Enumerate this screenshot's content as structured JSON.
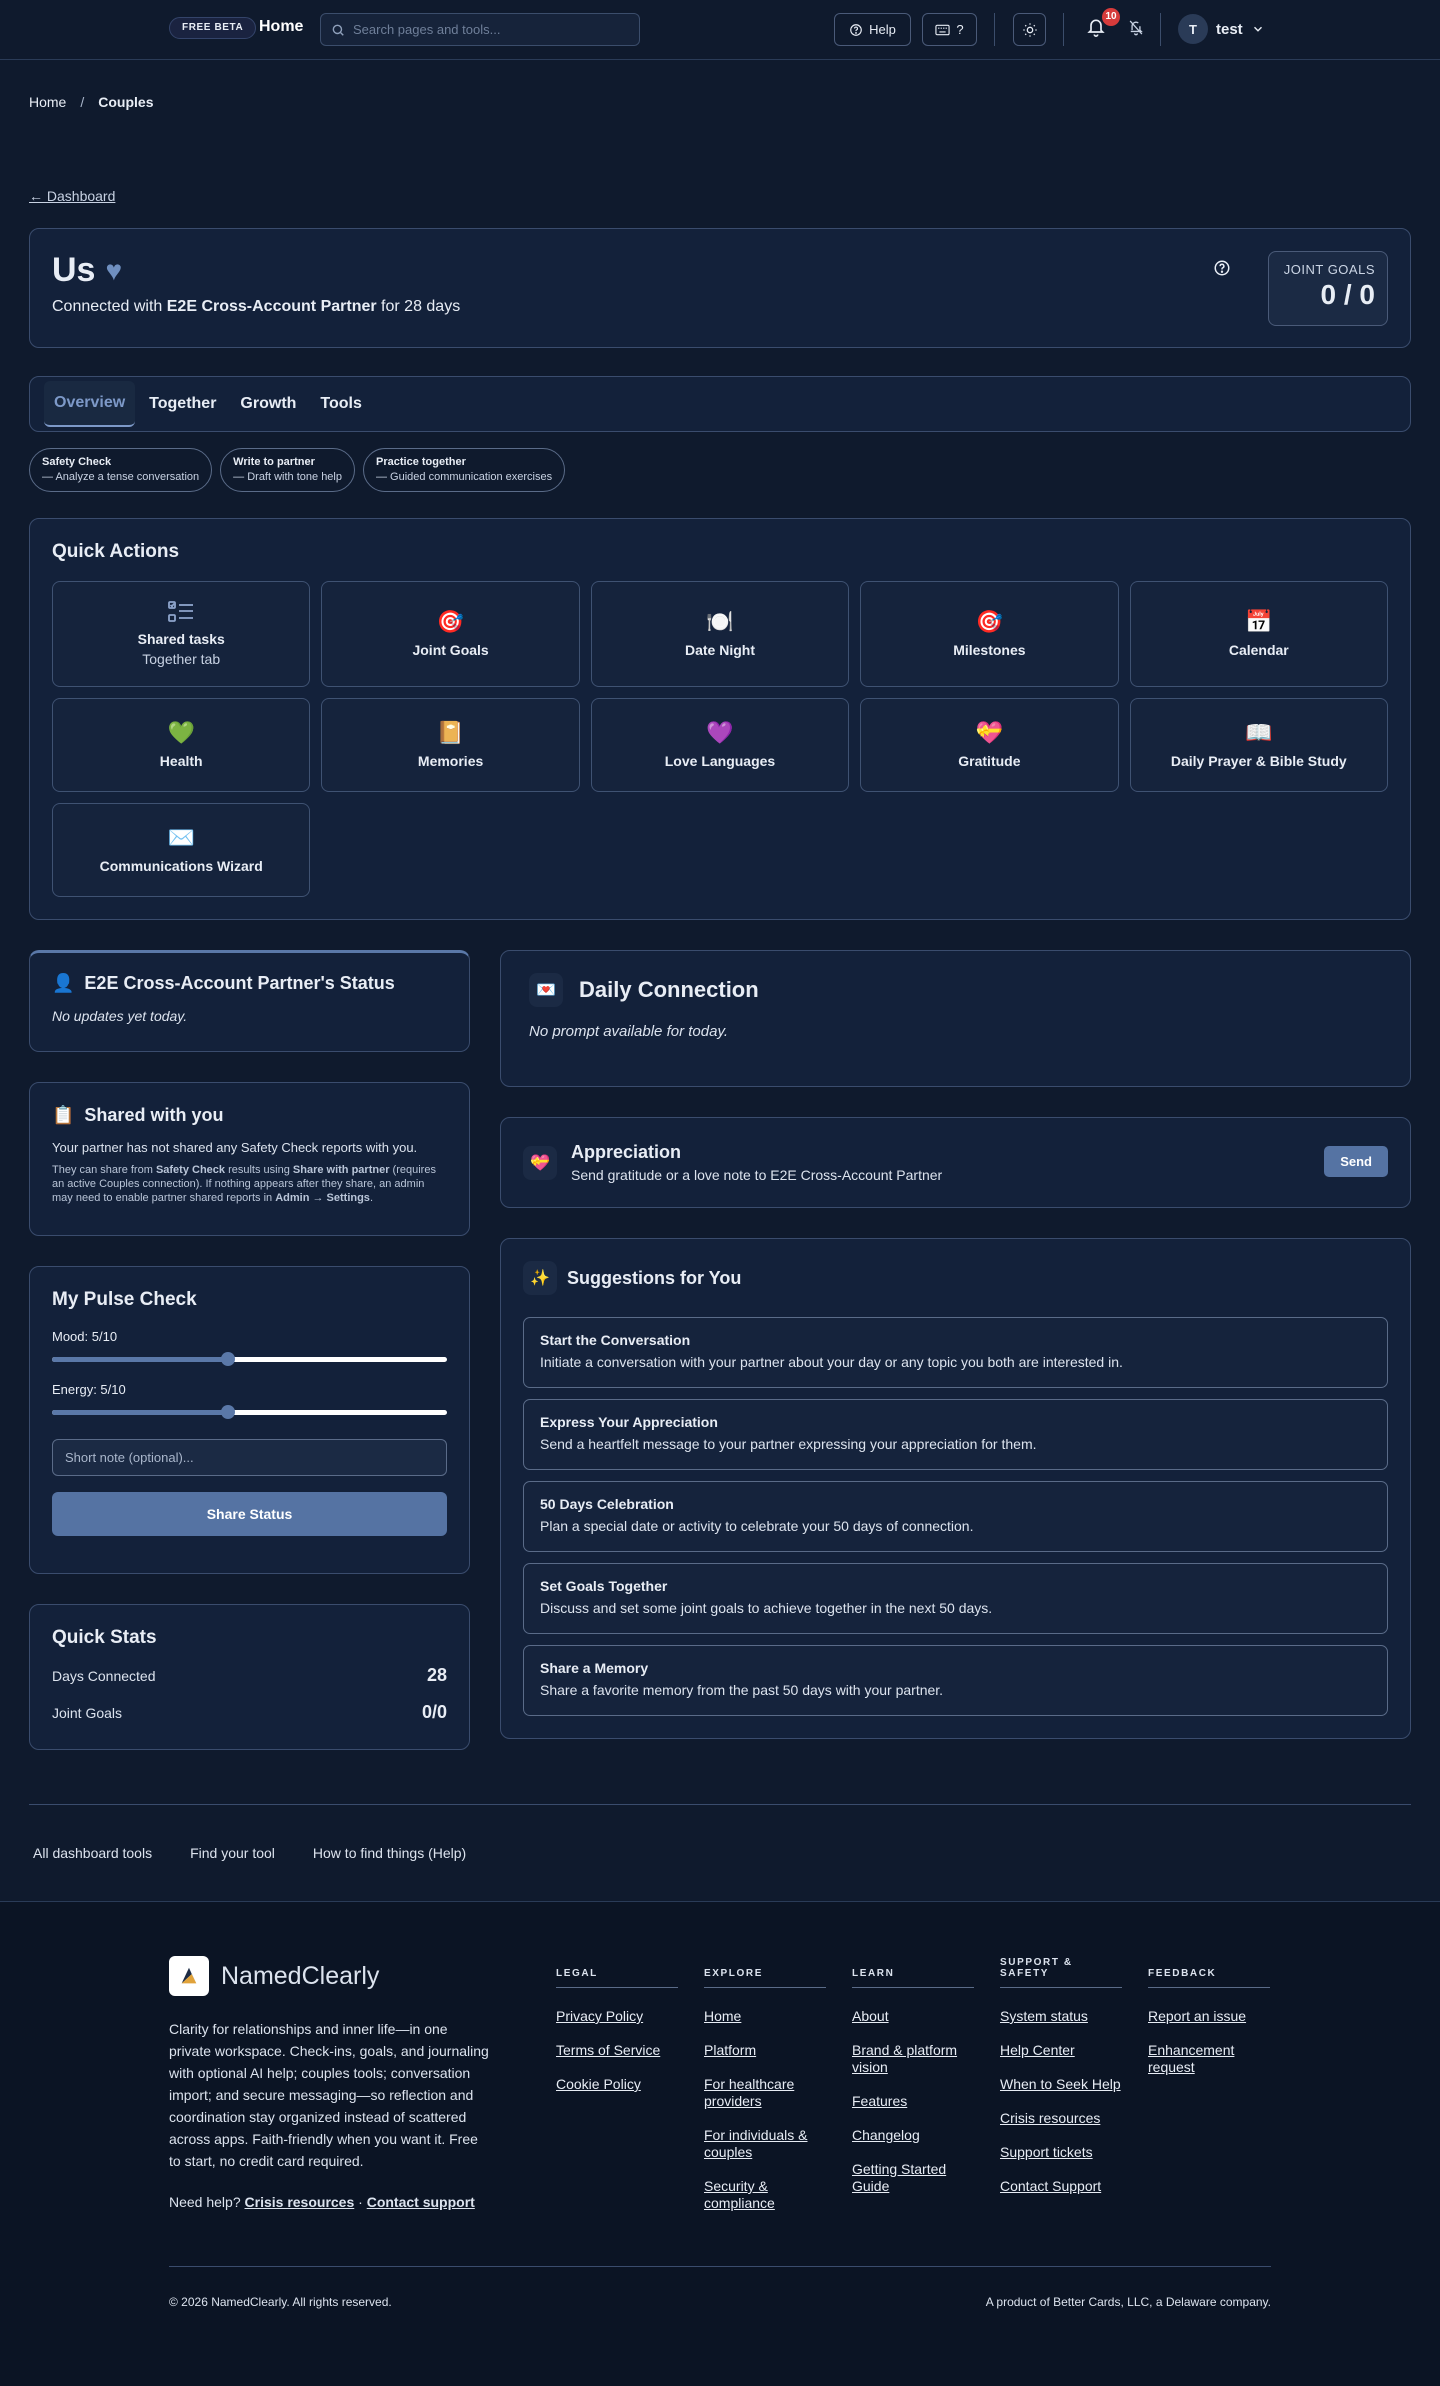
{
  "header": {
    "beta_label": "FREE BETA",
    "home_label": "Home",
    "search_placeholder": "Search pages and tools...",
    "help_label": "Help",
    "shortcuts_label": "?",
    "notification_count": "10",
    "user_initial": "T",
    "user_name": "test"
  },
  "breadcrumb": {
    "home": "Home",
    "sep": "/",
    "current": "Couples"
  },
  "back_link": "← Dashboard",
  "hero": {
    "title": "Us",
    "heart": "♥",
    "sub_prefix": "Connected with",
    "partner_name": "E2E Cross-Account Partner",
    "sub_suffix": "for 28 days",
    "goals_label": "JOINT GOALS",
    "goals_value": "0 / 0"
  },
  "tabs": [
    {
      "label": "Overview",
      "active": true
    },
    {
      "label": "Together"
    },
    {
      "label": "Growth"
    },
    {
      "label": "Tools"
    }
  ],
  "chips": [
    {
      "title": "Safety Check",
      "desc": "— Analyze a tense conversation"
    },
    {
      "title": "Write to partner",
      "desc": "— Draft with tone help"
    },
    {
      "title": "Practice together",
      "desc": "— Guided communication exercises"
    }
  ],
  "quick_actions": {
    "title": "Quick Actions",
    "items": [
      {
        "label": "Shared tasks",
        "sub": "Together tab",
        "icon": "checklist-icon"
      },
      {
        "label": "Joint Goals",
        "emoji": "🎯",
        "icon": "target-icon"
      },
      {
        "label": "Date Night",
        "emoji": "🍽️",
        "icon": "dinner-plate-icon"
      },
      {
        "label": "Milestones",
        "emoji": "🎯",
        "icon": "target-icon"
      },
      {
        "label": "Calendar",
        "emoji": "📅",
        "icon": "calendar-icon"
      },
      {
        "label": "Health",
        "emoji": "💚",
        "icon": "green-heart-icon"
      },
      {
        "label": "Memories",
        "emoji": "📔",
        "icon": "notebook-icon"
      },
      {
        "label": "Love Languages",
        "emoji": "💜",
        "icon": "purple-heart-icon"
      },
      {
        "label": "Gratitude",
        "emoji": "💝",
        "icon": "heart-gift-icon"
      },
      {
        "label": "Daily Prayer & Bible Study",
        "emoji": "📖",
        "icon": "open-book-icon"
      },
      {
        "label": "Communications Wizard",
        "emoji": "✉️",
        "icon": "envelope-icon"
      }
    ]
  },
  "partner_status": {
    "icon": "👤",
    "title": "E2E Cross-Account Partner's Status",
    "empty": "No updates yet today."
  },
  "shared": {
    "icon": "📋",
    "title": "Shared with you",
    "p1": "Your partner has not shared any Safety Check reports with you.",
    "p2_a": "They can share from ",
    "p2_b": "Safety Check",
    "p2_c": " results using ",
    "p2_d": "Share with partner",
    "p2_e": " (requires an active Couples connection). If nothing appears after they share, an admin may need to enable partner shared reports in ",
    "p2_f": "Admin → Settings",
    "p2_g": "."
  },
  "pulse": {
    "title": "My Pulse Check",
    "mood_label": "Mood: 5/10",
    "mood_value": 0.445,
    "energy_label": "Energy: 5/10",
    "energy_value": 0.445,
    "note_placeholder": "Short note (optional)...",
    "share_label": "Share Status"
  },
  "stats": {
    "title": "Quick Stats",
    "rows": [
      {
        "label": "Days Connected",
        "value": "28"
      },
      {
        "label": "Joint Goals",
        "value": "0/0"
      }
    ]
  },
  "daily": {
    "icon": "💌",
    "title": "Daily Connection",
    "empty": "No prompt available for today."
  },
  "appreciation": {
    "icon": "💝",
    "title": "Appreciation",
    "sub": "Send gratitude or a love note to E2E Cross-Account Partner",
    "send_label": "Send"
  },
  "suggestions": {
    "icon": "✨",
    "title": "Suggestions for You",
    "items": [
      {
        "title": "Start the Conversation",
        "desc": "Initiate a conversation with your partner about your day or any topic you both are interested in."
      },
      {
        "title": "Express Your Appreciation",
        "desc": "Send a heartfelt message to your partner expressing your appreciation for them."
      },
      {
        "title": "50 Days Celebration",
        "desc": "Plan a special date or activity to celebrate your 50 days of connection."
      },
      {
        "title": "Set Goals Together",
        "desc": "Discuss and set some joint goals to achieve together in the next 50 days."
      },
      {
        "title": "Share a Memory",
        "desc": "Share a favorite memory from the past 50 days with your partner."
      }
    ]
  },
  "dash_links": [
    "All dashboard tools",
    "Find your tool",
    "How to find things (Help)"
  ],
  "footer": {
    "brand": "NamedClearly",
    "desc": "Clarity for relationships and inner life—in one private workspace. Check-ins, goals, and journaling with optional AI help; couples tools; conversation import; and secure messaging—so reflection and coordination stay organized instead of scattered across apps. Faith-friendly when you want it. Free to start, no credit card required.",
    "need_help": "Need help?",
    "crisis": "Crisis resources",
    "dot": "·",
    "contact": "Contact support",
    "columns": [
      {
        "title": "LEGAL",
        "links": [
          "Privacy Policy",
          "Terms of Service",
          "Cookie Policy"
        ]
      },
      {
        "title": "EXPLORE",
        "links": [
          "Home",
          "Platform",
          "For healthcare providers",
          "For individuals & couples",
          "Security & compliance"
        ]
      },
      {
        "title": "LEARN",
        "links": [
          "About",
          "Brand & platform vision",
          "Features",
          "Changelog",
          "Getting Started Guide"
        ]
      },
      {
        "title": "SUPPORT & SAFETY",
        "links": [
          "System status",
          "Help Center",
          "When to Seek Help",
          "Crisis resources",
          "Support tickets",
          "Contact Support"
        ]
      },
      {
        "title": "FEEDBACK",
        "links": [
          "Report an issue",
          "Enhancement request"
        ]
      }
    ],
    "copyright": "© 2026 NamedClearly. All rights reserved.",
    "company": "A product of Better Cards, LLC, a Delaware company."
  }
}
